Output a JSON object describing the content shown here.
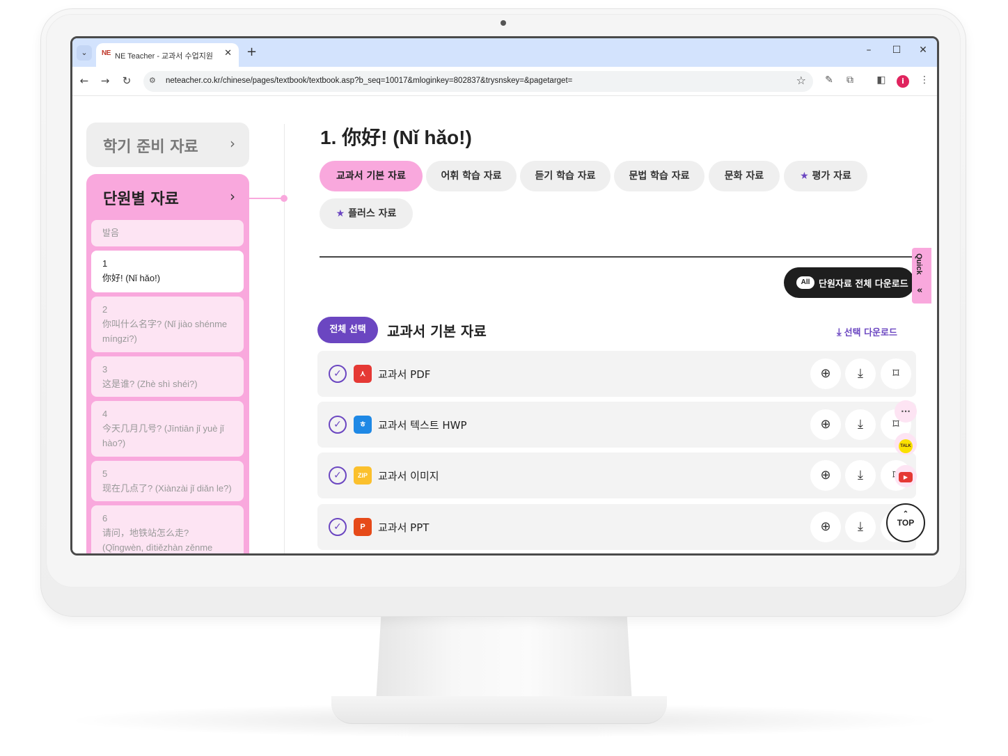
{
  "browser": {
    "tab_title": "NE Teacher - 교과서 수업지원",
    "tab_favicon": "NE",
    "url": "neteacher.co.kr/chinese/pages/textbook/textbook.asp?b_seq=10017&mloginkey=802837&trysnskey=&pagetarget=",
    "profile_initial": "i",
    "icons": [
      "chevron-down-icon",
      "close-icon",
      "plus-icon",
      "minimize-icon",
      "maximize-icon",
      "back-icon",
      "forward-icon",
      "reload-icon",
      "site-info-icon",
      "star-icon",
      "extension-icon",
      "puzzle-icon",
      "side-panel-icon",
      "kebab-menu-icon"
    ]
  },
  "sidebar": {
    "prep_label": "학기 준비 자료",
    "unit_label": "단원별 자료",
    "items": [
      {
        "num": "",
        "text": "발음"
      },
      {
        "num": "1",
        "text": "你好! (Nǐ hǎo!)"
      },
      {
        "num": "2",
        "text": "你叫什么名字? (Nǐ jiào shénme míngzi?)"
      },
      {
        "num": "3",
        "text": "这是谁? (Zhè shì shéi?)"
      },
      {
        "num": "4",
        "text": "今天几月几号? (Jīntiān jǐ yuè jǐ hào?)"
      },
      {
        "num": "5",
        "text": "现在几点了? (Xiànzài jǐ diǎn le?)"
      },
      {
        "num": "6",
        "text": "请问，地铁站怎么走? (Qǐngwèn, dìtiězhàn zěnme zǒu?)"
      }
    ]
  },
  "main": {
    "unit_title": "1. 你好! (Nǐ hǎo!)",
    "categories": [
      {
        "label": "교과서 기본 자료",
        "star": false
      },
      {
        "label": "어휘 학습 자료",
        "star": false
      },
      {
        "label": "듣기 학습 자료",
        "star": false
      },
      {
        "label": "문법 학습 자료",
        "star": false
      },
      {
        "label": "문화 자료",
        "star": false
      },
      {
        "label": "평가 자료",
        "star": true
      },
      {
        "label": "플러스 자료",
        "star": true
      }
    ],
    "all_download_badge": "All",
    "all_download_label": "단원자료 전체 다운로드",
    "quick_label": "Quick",
    "select_all_label": "전체 선택",
    "section_title": "교과서 기본 자료",
    "selected_download_label": "선택 다운로드",
    "resources": [
      {
        "label": "교과서 PDF",
        "type": "pdf",
        "icon_text": "",
        "color": "#e53935"
      },
      {
        "label": "교과서 텍스트 HWP",
        "type": "hwp",
        "icon_text": "ㅎ",
        "color": "#1e88e5"
      },
      {
        "label": "교과서 이미지",
        "type": "zip",
        "icon_text": "ZIP",
        "color": "#fbc02d"
      },
      {
        "label": "교과서 PPT",
        "type": "ppt",
        "icon_text": "P",
        "color": "#e64a19"
      }
    ],
    "top_label": "TOP",
    "talk_label": "TALK",
    "brand_color": "#f9a8dd",
    "accent_color": "#6b46c1"
  }
}
